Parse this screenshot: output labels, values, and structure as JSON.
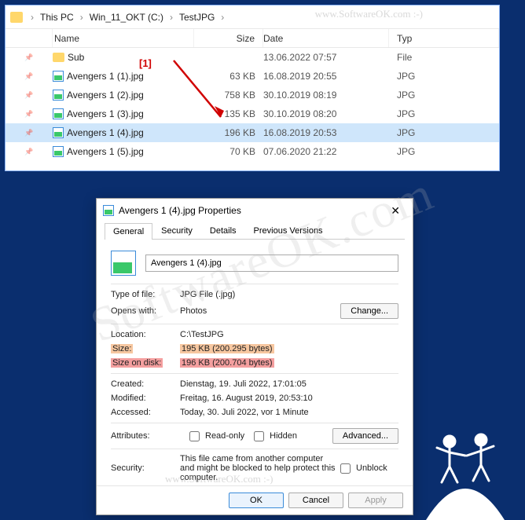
{
  "breadcrumb": {
    "segments": [
      "This PC",
      "Win_11_OKT (C:)",
      "TestJPG"
    ]
  },
  "columns": {
    "name": "Name",
    "size": "Size",
    "date": "Date",
    "type": "Typ"
  },
  "annotation": {
    "label": "[1]"
  },
  "files": [
    {
      "name": "Sub",
      "size": "",
      "date": "13.06.2022 07:57",
      "type": "File",
      "kind": "folder"
    },
    {
      "name": "Avengers 1 (1).jpg",
      "size": "63 KB",
      "date": "16.08.2019 20:55",
      "type": "JPG",
      "kind": "image"
    },
    {
      "name": "Avengers 1 (2).jpg",
      "size": "758 KB",
      "date": "30.10.2019 08:19",
      "type": "JPG",
      "kind": "image"
    },
    {
      "name": "Avengers 1 (3).jpg",
      "size": "135 KB",
      "date": "30.10.2019 08:20",
      "type": "JPG",
      "kind": "image"
    },
    {
      "name": "Avengers 1 (4).jpg",
      "size": "196 KB",
      "date": "16.08.2019 20:53",
      "type": "JPG",
      "kind": "image",
      "selected": true
    },
    {
      "name": "Avengers 1 (5).jpg",
      "size": "70 KB",
      "date": "07.06.2020 21:22",
      "type": "JPG",
      "kind": "image"
    }
  ],
  "dialog": {
    "title": "Avengers 1 (4).jpg Properties",
    "tabs": [
      "General",
      "Security",
      "Details",
      "Previous Versions"
    ],
    "filename": "Avengers 1 (4).jpg",
    "type_label": "Type of file:",
    "type_value": "JPG File (.jpg)",
    "opens_label": "Opens with:",
    "opens_value": "Photos",
    "change_btn": "Change...",
    "location_label": "Location:",
    "location_value": "C:\\TestJPG",
    "size_label": "Size:",
    "size_value": "195 KB (200.295 bytes)",
    "disk_label": "Size on disk:",
    "disk_value": "196 KB (200.704 bytes)",
    "created_label": "Created:",
    "created_value": "Dienstag, 19. Juli 2022, 17:01:05",
    "modified_label": "Modified:",
    "modified_value": "Freitag, 16. August 2019, 20:53:10",
    "accessed_label": "Accessed:",
    "accessed_value": "Today, 30. Juli 2022, vor 1 Minute",
    "attributes_label": "Attributes:",
    "readonly": "Read-only",
    "hidden": "Hidden",
    "advanced_btn": "Advanced...",
    "security_label": "Security:",
    "security_text": "This file came from another computer and might be blocked to help protect this computer.",
    "unblock": "Unblock",
    "ok": "OK",
    "cancel": "Cancel",
    "apply": "Apply"
  },
  "watermark": {
    "main": "SoftwareOK.com",
    "small": "www.SoftwareOK.com  :-)"
  }
}
